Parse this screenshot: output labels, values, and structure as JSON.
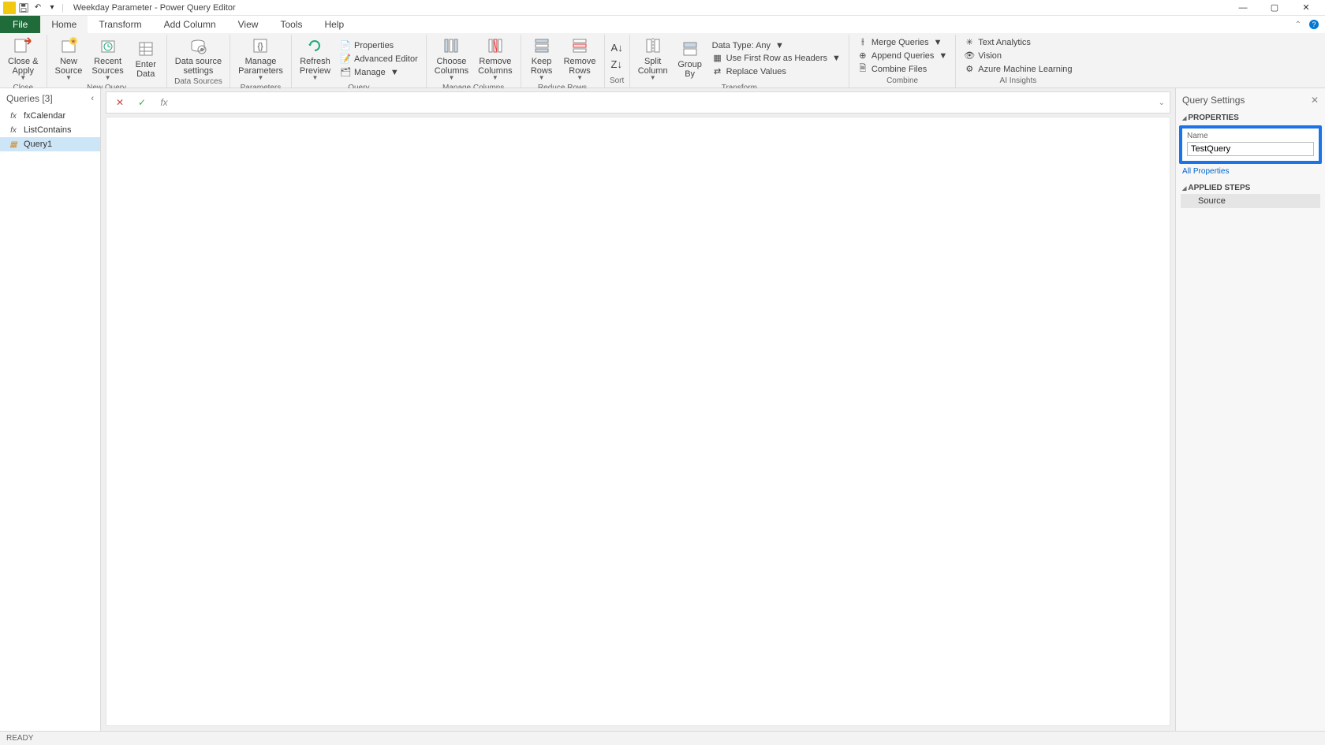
{
  "title": "Weekday Parameter - Power Query Editor",
  "tabs": {
    "file": "File",
    "home": "Home",
    "transform": "Transform",
    "add_column": "Add Column",
    "view": "View",
    "tools": "Tools",
    "help": "Help"
  },
  "ribbon": {
    "close": {
      "close_apply": "Close &\nApply",
      "group": "Close"
    },
    "newquery": {
      "new_source": "New\nSource",
      "recent_sources": "Recent\nSources",
      "enter_data": "Enter\nData",
      "group": "New Query"
    },
    "datasources": {
      "data_source_settings": "Data source\nsettings",
      "group": "Data Sources"
    },
    "parameters": {
      "manage_parameters": "Manage\nParameters",
      "group": "Parameters"
    },
    "query": {
      "refresh_preview": "Refresh\nPreview",
      "properties": "Properties",
      "advanced_editor": "Advanced Editor",
      "manage": "Manage",
      "group": "Query"
    },
    "manage_columns": {
      "choose": "Choose\nColumns",
      "remove": "Remove\nColumns",
      "group": "Manage Columns"
    },
    "reduce_rows": {
      "keep": "Keep\nRows",
      "remove": "Remove\nRows",
      "group": "Reduce Rows"
    },
    "sort": {
      "group": "Sort"
    },
    "transform": {
      "split": "Split\nColumn",
      "group_by": "Group\nBy",
      "data_type": "Data Type: Any",
      "first_row": "Use First Row as Headers",
      "replace": "Replace Values",
      "group": "Transform"
    },
    "combine": {
      "merge": "Merge Queries",
      "append": "Append Queries",
      "combine_files": "Combine Files",
      "group": "Combine"
    },
    "ai": {
      "text_analytics": "Text Analytics",
      "vision": "Vision",
      "azure_ml": "Azure Machine Learning",
      "group": "AI Insights"
    }
  },
  "queries_pane": {
    "title": "Queries [3]",
    "items": [
      {
        "name": "fxCalendar",
        "icon": "fx"
      },
      {
        "name": "ListContains",
        "icon": "fx"
      },
      {
        "name": "Query1",
        "icon": "table"
      }
    ]
  },
  "formula": "",
  "settings": {
    "title": "Query Settings",
    "properties_title": "PROPERTIES",
    "name_label": "Name",
    "name_value": "TestQuery",
    "all_properties": "All Properties",
    "steps_title": "APPLIED STEPS",
    "steps": [
      "Source"
    ]
  },
  "status": "READY"
}
